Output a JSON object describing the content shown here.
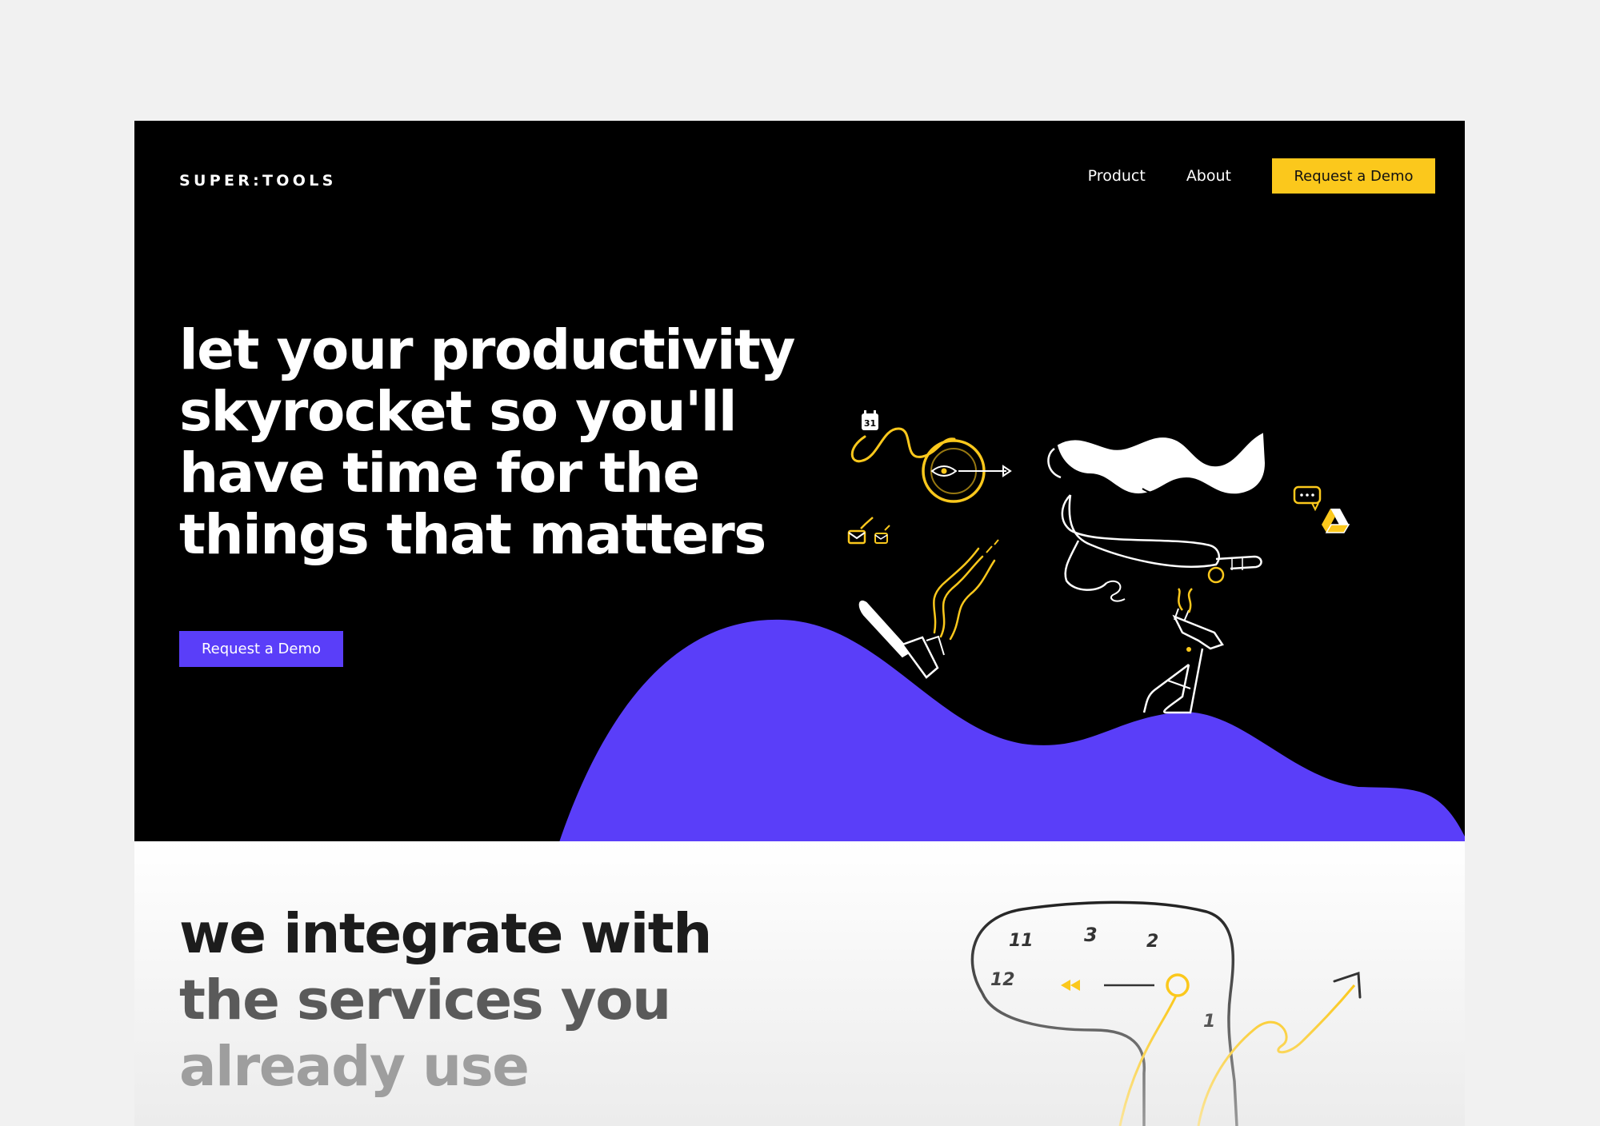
{
  "brand": {
    "logo": "SUPER:TOOLS"
  },
  "nav": {
    "product": "Product",
    "about": "About",
    "cta": "Request a Demo"
  },
  "hero": {
    "headline": "let your productivity skyrocket so you'll have time for the things that matters",
    "cta": "Request a Demo",
    "calendar_badge": "31"
  },
  "integrations": {
    "heading_line1": "we integrate with",
    "heading_line2": "the services you",
    "heading_line3": "already use",
    "clock_numbers": [
      "11",
      "3",
      "2",
      "12",
      "1"
    ]
  },
  "colors": {
    "accent_yellow": "#fbc81c",
    "accent_purple": "#5a3ef9",
    "hero_background": "#000000"
  }
}
